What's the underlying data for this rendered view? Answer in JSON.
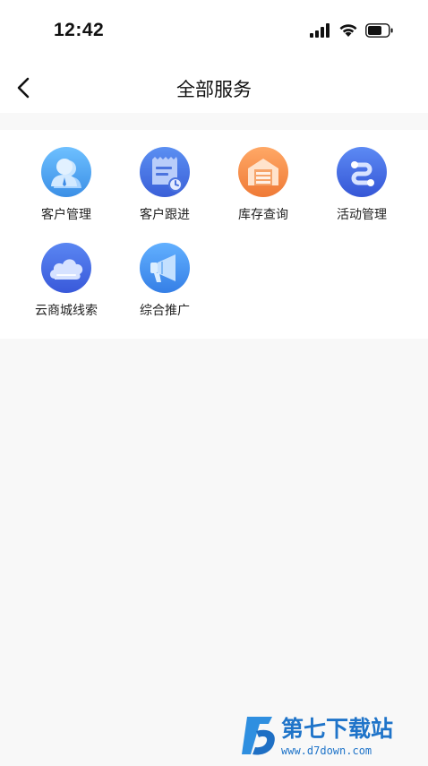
{
  "status": {
    "time": "12:42"
  },
  "header": {
    "title": "全部服务"
  },
  "services": [
    {
      "label": "客户管理",
      "icon": "customer-icon",
      "color": "#4aa3f0"
    },
    {
      "label": "客户跟进",
      "icon": "follow-up-icon",
      "color": "#3f73e8"
    },
    {
      "label": "库存查询",
      "icon": "warehouse-icon",
      "color": "#f48a42"
    },
    {
      "label": "活动管理",
      "icon": "activity-icon",
      "color": "#3e6ee6"
    },
    {
      "label": "云商城线索",
      "icon": "cloud-icon",
      "color": "#3f70ea"
    },
    {
      "label": "综合推广",
      "icon": "megaphone-icon",
      "color": "#3d8ef0"
    }
  ],
  "watermark": {
    "brand": "第七下载站",
    "url": "www.d7down.com"
  }
}
